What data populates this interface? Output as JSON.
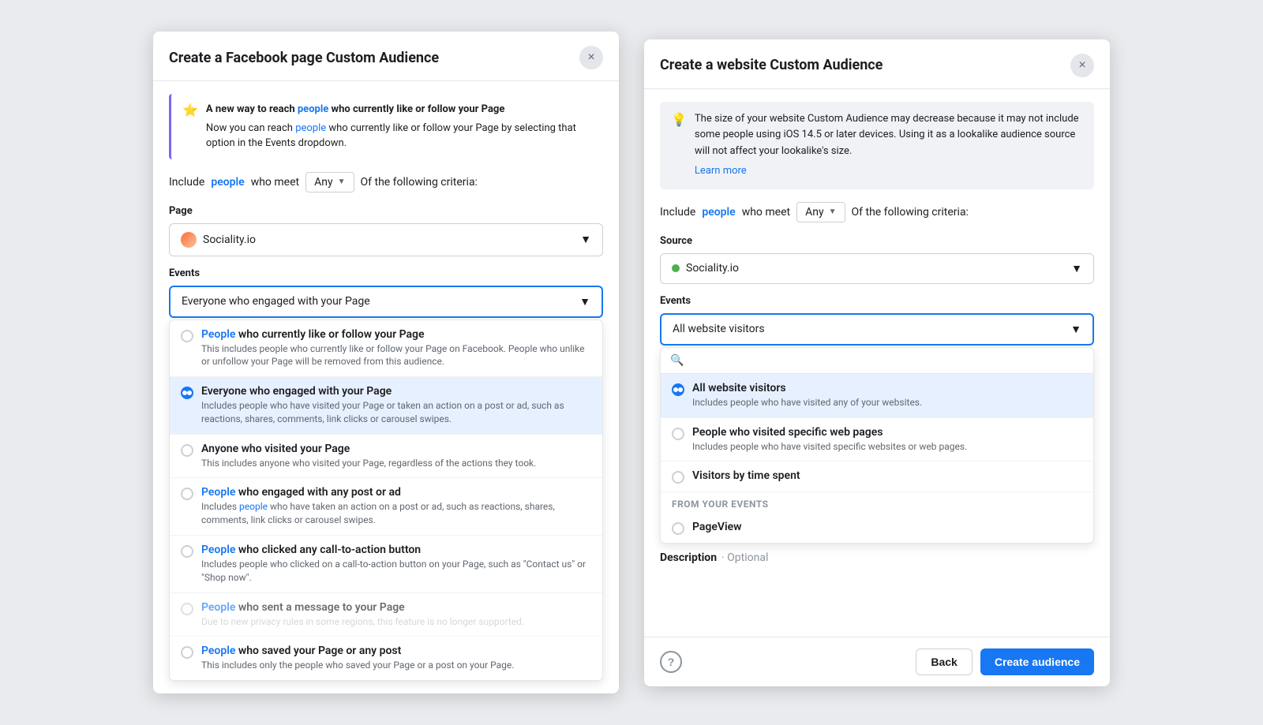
{
  "modal_left": {
    "title": "Create a Facebook page Custom Audience",
    "close_label": "×",
    "banner": {
      "icon": "⭐",
      "headline": "A new way to reach people who currently like or follow your Page",
      "body": "Now you can reach people who currently like or follow your Page by selecting that option in the Events dropdown.",
      "people_link": "people"
    },
    "criteria": {
      "prefix": "Include",
      "people_label": "people",
      "middle": "who meet",
      "dropdown_value": "Any",
      "suffix": "Of the following criteria:"
    },
    "page_label": "Page",
    "page_value": "Sociality.io",
    "events_label": "Events",
    "events_selected": "Everyone who engaged with your Page",
    "dropdown_items": [
      {
        "id": "item1",
        "title_prefix": "",
        "title_people": "People",
        "title_suffix": " who currently like or follow your Page",
        "desc": "This includes people who currently like or follow your Page on Facebook. People who unlike or unfollow your Page will be removed from this audience.",
        "selected": false,
        "disabled": false
      },
      {
        "id": "item2",
        "title_prefix": "Everyone who engaged with your Page",
        "title_people": "",
        "title_suffix": "",
        "desc": "Includes people who have visited your Page or taken an action on a post or ad, such as reactions, shares, comments, link clicks or carousel swipes.",
        "selected": true,
        "disabled": false
      },
      {
        "id": "item3",
        "title_prefix": "Anyone who visited your Page",
        "title_people": "",
        "title_suffix": "",
        "desc": "This includes anyone who visited your Page, regardless of the actions they took.",
        "selected": false,
        "disabled": false
      },
      {
        "id": "item4",
        "title_prefix": "",
        "title_people": "People",
        "title_suffix": " who engaged with any post or ad",
        "desc_prefix": "Includes ",
        "desc_people": "people",
        "desc_suffix": " who have taken an action on a post or ad, such as reactions, shares, comments, link clicks or carousel swipes.",
        "selected": false,
        "disabled": false
      },
      {
        "id": "item5",
        "title_prefix": "",
        "title_people": "People",
        "title_suffix": " who clicked any call-to-action button",
        "desc": "Includes people who clicked on a call-to-action button on your Page, such as \"Contact us\" or \"Shop now\".",
        "selected": false,
        "disabled": false
      },
      {
        "id": "item6",
        "title_prefix": "",
        "title_people": "People",
        "title_suffix": " who sent a message to your Page",
        "desc": "Due to new privacy rules in some regions, this feature is no longer supported.",
        "selected": false,
        "disabled": true
      },
      {
        "id": "item7",
        "title_prefix": "",
        "title_people": "People",
        "title_suffix": " who saved your Page or any post",
        "desc": "This includes only the people who saved your Page or a post on your Page.",
        "selected": false,
        "disabled": false
      }
    ]
  },
  "modal_right": {
    "title": "Create a website Custom Audience",
    "close_label": "×",
    "notice": {
      "icon": "💡",
      "text": "The size of your website Custom Audience may decrease because it may not include some people using iOS 14.5 or later devices. Using it as a lookalike audience source will not affect your lookalike's size.",
      "learn_more": "Learn more"
    },
    "criteria": {
      "prefix": "Include",
      "people_label": "people",
      "middle": "who meet",
      "dropdown_value": "Any",
      "suffix": "Of the following criteria:"
    },
    "source_label": "Source",
    "source_value": "Sociality.io",
    "events_label": "Events",
    "events_selected": "All website visitors",
    "search_placeholder": "",
    "dropdown_items": [
      {
        "id": "all-visitors",
        "title": "All website visitors",
        "desc": "Includes people who have visited any of your websites.",
        "selected": true
      },
      {
        "id": "specific-pages",
        "title": "People who visited specific web pages",
        "desc": "Includes people who have visited specific websites or web pages.",
        "selected": false
      },
      {
        "id": "time-spent",
        "title": "Visitors by time spent",
        "desc": "",
        "selected": false
      }
    ],
    "from_your_events_label": "From your events",
    "pageview_label": "PageView",
    "description_label": "Description",
    "description_optional": "· Optional",
    "footer": {
      "help_icon": "?",
      "back_btn": "Back",
      "create_btn": "Create audience"
    }
  }
}
